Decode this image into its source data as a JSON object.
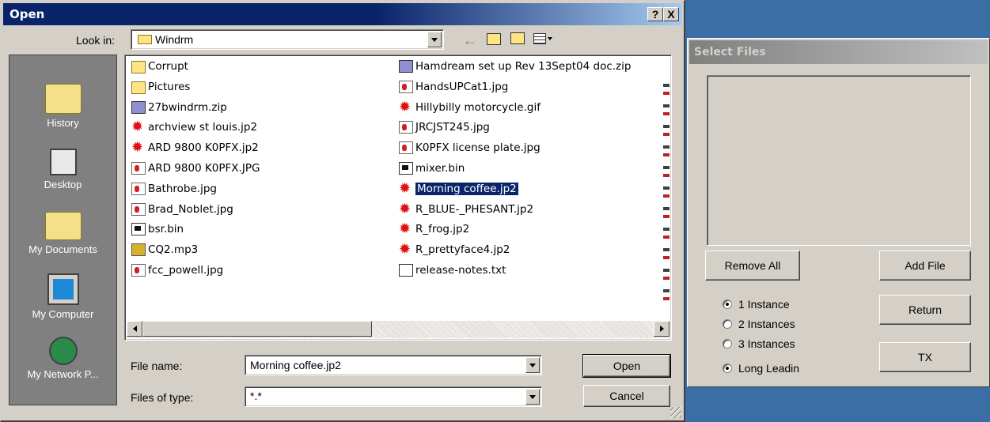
{
  "open_dialog": {
    "title": "Open",
    "help_btn": "?",
    "close_btn": "X",
    "look_in_label": "Look in:",
    "look_in_value": "Windrm",
    "places": [
      {
        "label": "History",
        "icon": "history-icon"
      },
      {
        "label": "Desktop",
        "icon": "desktop-icon"
      },
      {
        "label": "My Documents",
        "icon": "my-documents-icon"
      },
      {
        "label": "My Computer",
        "icon": "my-computer-icon"
      },
      {
        "label": "My Network P...",
        "icon": "network-places-icon"
      }
    ],
    "files_col1": [
      {
        "name": "Corrupt",
        "type": "folder"
      },
      {
        "name": "Pictures",
        "type": "folder"
      },
      {
        "name": "27bwindrm.zip",
        "type": "zip"
      },
      {
        "name": "archview st louis.jp2",
        "type": "star"
      },
      {
        "name": "ARD 9800 K0PFX.jp2",
        "type": "star"
      },
      {
        "name": "ARD 9800 K0PFX.JPG",
        "type": "jpg"
      },
      {
        "name": "Bathrobe.jpg",
        "type": "jpg"
      },
      {
        "name": "Brad_Noblet.jpg",
        "type": "jpg"
      },
      {
        "name": "bsr.bin",
        "type": "bin"
      },
      {
        "name": "CQ2.mp3",
        "type": "mp3"
      },
      {
        "name": "fcc_powell.jpg",
        "type": "jpg"
      }
    ],
    "files_col2": [
      {
        "name": "Hamdream set up Rev 13Sept04 doc.zip",
        "type": "zip"
      },
      {
        "name": "HandsUPCat1.jpg",
        "type": "jpg"
      },
      {
        "name": "Hillybilly motorcycle.gif",
        "type": "star"
      },
      {
        "name": "JRCJST245.jpg",
        "type": "jpg"
      },
      {
        "name": "K0PFX license plate.jpg",
        "type": "jpg"
      },
      {
        "name": "mixer.bin",
        "type": "bin"
      },
      {
        "name": "Morning coffee.jp2",
        "type": "star",
        "selected": true
      },
      {
        "name": "R_BLUE-_PHESANT.jp2",
        "type": "star"
      },
      {
        "name": "R_frog.jp2",
        "type": "star"
      },
      {
        "name": "R_prettyface4.jp2",
        "type": "star"
      },
      {
        "name": "release-notes.txt",
        "type": "txt"
      }
    ],
    "file_name_label": "File name:",
    "file_name_value": "Morning coffee.jp2",
    "files_of_type_label": "Files of type:",
    "files_of_type_value": "*.*",
    "open_button": "Open",
    "cancel_button": "Cancel"
  },
  "select_files": {
    "title": "Select Files",
    "remove_all_button": "Remove All",
    "add_file_button": "Add File",
    "return_button": "Return",
    "tx_button": "TX",
    "options": [
      {
        "label": "1 Instance",
        "checked": true
      },
      {
        "label": "2 Instances",
        "checked": false
      },
      {
        "label": "3 Instances",
        "checked": false
      },
      {
        "label": "Long Leadin",
        "checked": true
      }
    ]
  },
  "colors": {
    "title_active": "#0a246a",
    "face": "#d4d0c8",
    "desktop": "#3a6ea5",
    "selection": "#0a246a"
  }
}
